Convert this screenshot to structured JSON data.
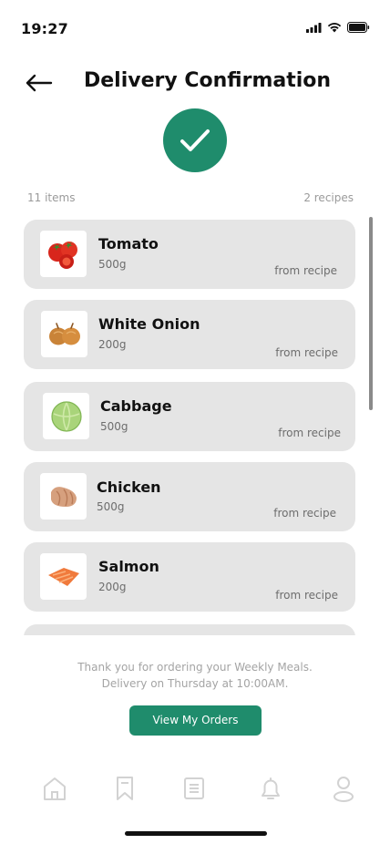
{
  "status_bar": {
    "time": "19:27",
    "icons": [
      "signal-icon",
      "wifi-icon",
      "battery-icon"
    ]
  },
  "header": {
    "back_icon": "arrow-left-icon",
    "title": "Delivery Confirmation"
  },
  "confirmation": {
    "icon": "check-icon",
    "accent_color": "#1f8c6c"
  },
  "summary": {
    "items_count": "11 items",
    "recipes_count": "2 recipes"
  },
  "items": [
    {
      "name": "Tomato",
      "quantity": "500g",
      "source": "from recipe",
      "icon": "tomato-icon"
    },
    {
      "name": "White Onion",
      "quantity": "200g",
      "source": "from recipe",
      "icon": "onion-icon"
    },
    {
      "name": "Cabbage",
      "quantity": "500g",
      "source": "from recipe",
      "icon": "cabbage-icon"
    },
    {
      "name": "Chicken",
      "quantity": "500g",
      "source": "from recipe",
      "icon": "chicken-icon"
    },
    {
      "name": "Salmon",
      "quantity": "200g",
      "source": "from recipe",
      "icon": "salmon-icon"
    }
  ],
  "footer": {
    "thanks_line1": "Thank you for ordering your Weekly Meals.",
    "thanks_line2": "Delivery on Thursday at 10:00AM.",
    "button_label": "View My Orders"
  },
  "bottom_nav": {
    "items": [
      "home-icon",
      "bookmark-icon",
      "list-icon",
      "bell-icon",
      "profile-icon"
    ]
  }
}
